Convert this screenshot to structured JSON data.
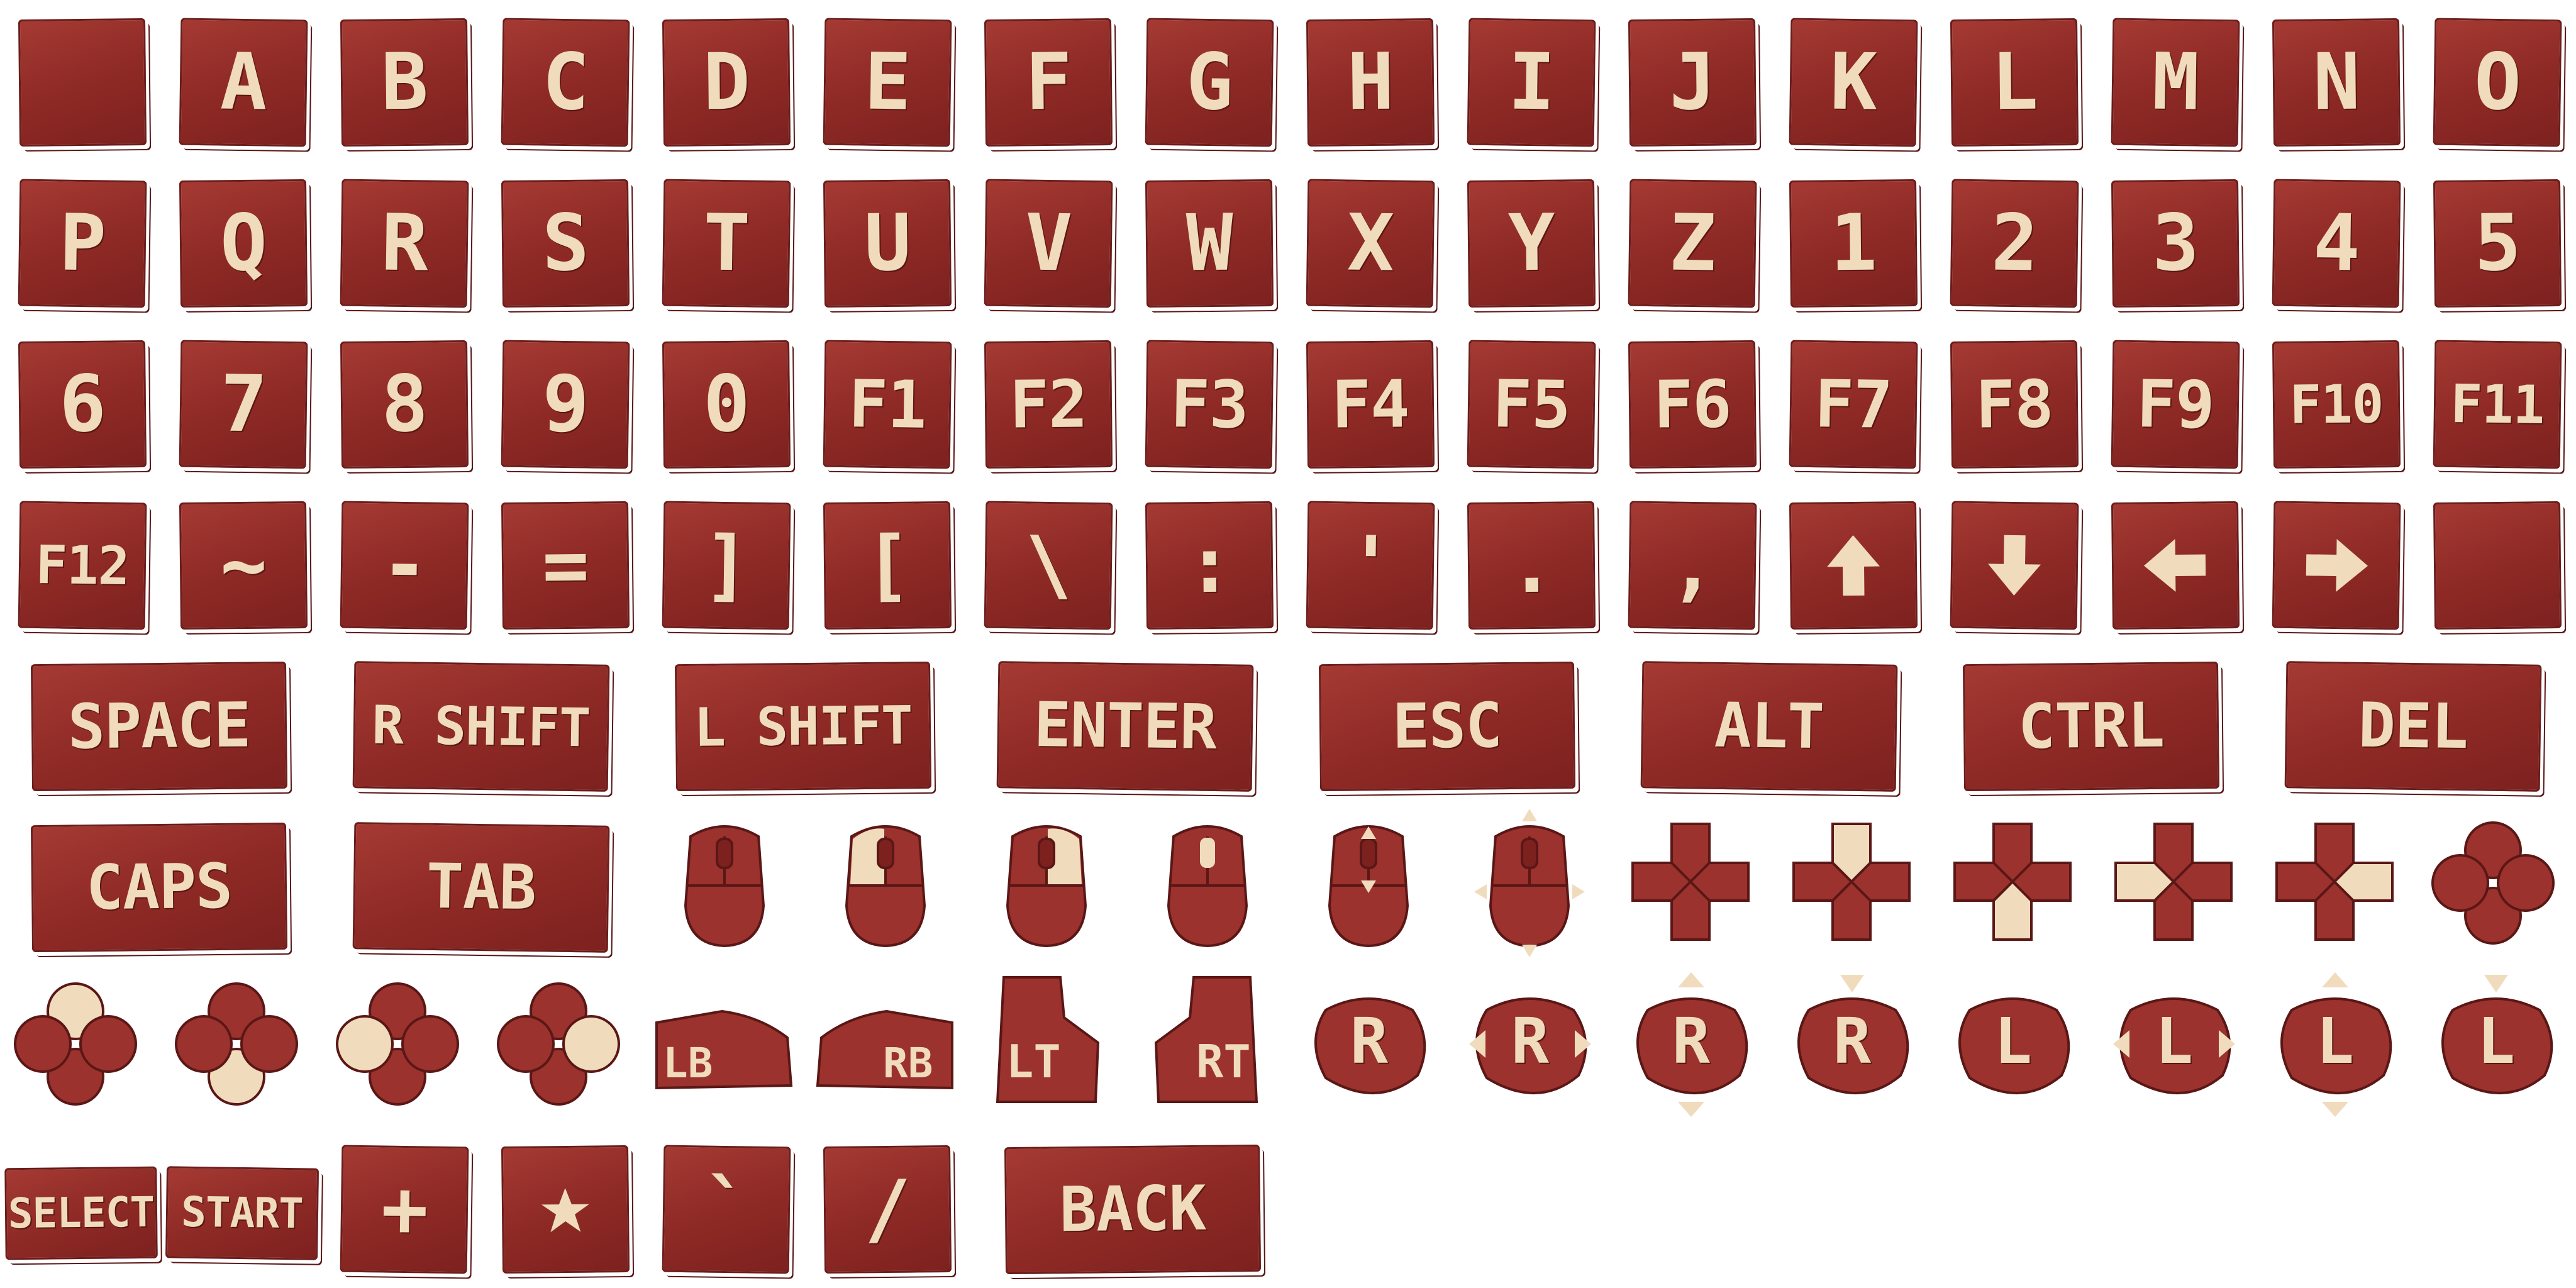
{
  "sheet": {
    "rows": [
      [
        "",
        "A",
        "B",
        "C",
        "D",
        "E",
        "F",
        "G",
        "H",
        "I",
        "J",
        "K",
        "L",
        "M",
        "N",
        "O"
      ],
      [
        "P",
        "Q",
        "R",
        "S",
        "T",
        "U",
        "V",
        "W",
        "X",
        "Y",
        "Z",
        "1",
        "2",
        "3",
        "4",
        "5"
      ],
      [
        "6",
        "7",
        "8",
        "9",
        "0",
        "F1",
        "F2",
        "F3",
        "F4",
        "F5",
        "F6",
        "F7",
        "F8",
        "F9",
        "F10",
        "F11"
      ],
      [
        "F12",
        "~",
        "-",
        "=",
        "]",
        "[",
        "\\",
        ":",
        "'",
        ".",
        ",",
        "arrow-up-icon",
        "arrow-down-icon",
        "arrow-left-icon",
        "arrow-right-icon",
        ""
      ]
    ],
    "wide_keys": [
      "SPACE",
      "R SHIFT",
      "L SHIFT",
      "ENTER",
      "ESC",
      "ALT",
      "CTRL",
      "DEL"
    ],
    "row6_keys": [
      "CAPS",
      "TAB"
    ],
    "mouse_icons": [
      "mouse-icon",
      "mouse-left-click-icon",
      "mouse-right-click-icon",
      "mouse-middle-click-icon",
      "mouse-scroll-icon",
      "mouse-move-icon"
    ],
    "dpad_icons": [
      "dpad-icon",
      "dpad-up-icon",
      "dpad-down-icon",
      "dpad-left-icon",
      "dpad-right-icon"
    ],
    "face_button_icons": [
      "face-buttons-icon",
      "face-button-top-icon",
      "face-button-bottom-icon",
      "face-button-left-icon",
      "face-button-right-icon"
    ],
    "bumpers": [
      "LB",
      "RB"
    ],
    "triggers": [
      "LT",
      "RT"
    ],
    "sticks": [
      {
        "label": "R",
        "icon": "stick-right-icon"
      },
      {
        "label": "R",
        "icon": "stick-right-horizontal-icon"
      },
      {
        "label": "R",
        "icon": "stick-right-vertical-icon"
      },
      {
        "label": "R",
        "icon": "stick-right-press-icon"
      },
      {
        "label": "L",
        "icon": "stick-left-icon"
      },
      {
        "label": "L",
        "icon": "stick-left-horizontal-icon"
      },
      {
        "label": "L",
        "icon": "stick-left-vertical-icon"
      },
      {
        "label": "L",
        "icon": "stick-left-press-icon"
      }
    ],
    "last_row": [
      "SELECT",
      "START",
      "+",
      "star-icon",
      "`",
      "/",
      "BACK"
    ]
  },
  "colors": {
    "tile": "#9b322d",
    "tile_dark": "#6c1d1b",
    "letter": "#f0dcbc",
    "background": "#ffffff"
  }
}
